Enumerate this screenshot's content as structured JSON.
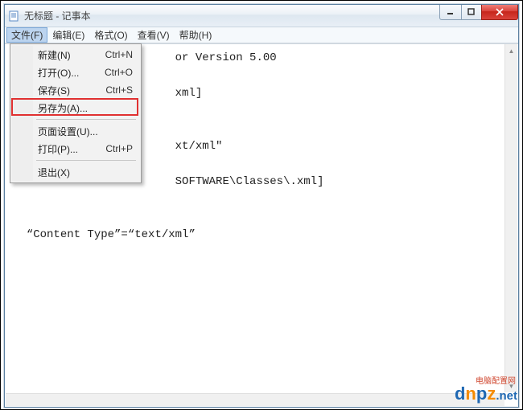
{
  "window": {
    "title": "无标题 - 记事本"
  },
  "menubar": {
    "items": [
      {
        "label": "文件(F)"
      },
      {
        "label": "编辑(E)"
      },
      {
        "label": "格式(O)"
      },
      {
        "label": "查看(V)"
      },
      {
        "label": "帮助(H)"
      }
    ]
  },
  "dropdown": {
    "items": [
      {
        "label": "新建(N)",
        "shortcut": "Ctrl+N"
      },
      {
        "label": "打开(O)...",
        "shortcut": "Ctrl+O"
      },
      {
        "label": "保存(S)",
        "shortcut": "Ctrl+S"
      },
      {
        "label": "另存为(A)...",
        "shortcut": ""
      },
      {
        "label": "页面设置(U)...",
        "shortcut": ""
      },
      {
        "label": "打印(P)...",
        "shortcut": "Ctrl+P"
      },
      {
        "label": "退出(X)",
        "shortcut": ""
      }
    ]
  },
  "editor": {
    "line1_suffix": "or Version 5.00",
    "line3_suffix": "xml]",
    "line6_suffix": "xt/xml\"",
    "line8_suffix": "SOFTWARE\\Classes\\.xml]",
    "line11": "“Content Type”=“text/xml”"
  },
  "watermark": {
    "sub": "电脑配置网",
    "d": "d",
    "n": "n",
    "p": "p",
    "z": "z",
    "net": ".net"
  }
}
